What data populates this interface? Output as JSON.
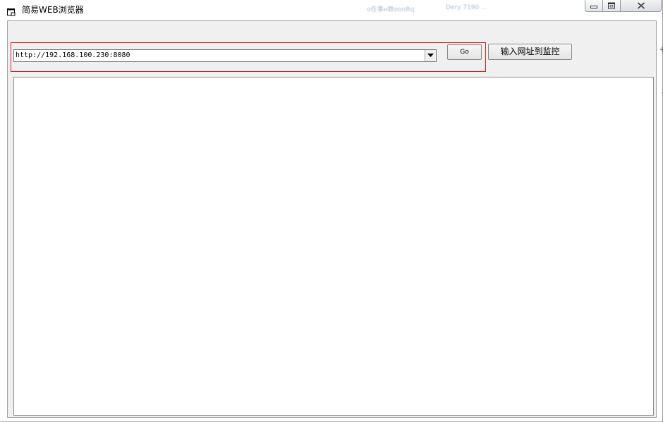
{
  "window": {
    "title": "简易WEB浏览器"
  },
  "background_window": {
    "text_1": "ɑ在事ʜ数oonRq",
    "text_2": "Dery 7190 ..."
  },
  "toolbar": {
    "url_value": "http://192.168.100.230:8080",
    "go_label": "Go",
    "monitor_label": "输入网址到监控"
  },
  "colors": {
    "highlight_border": "#e0192a",
    "client_background": "#f0f0f0"
  }
}
